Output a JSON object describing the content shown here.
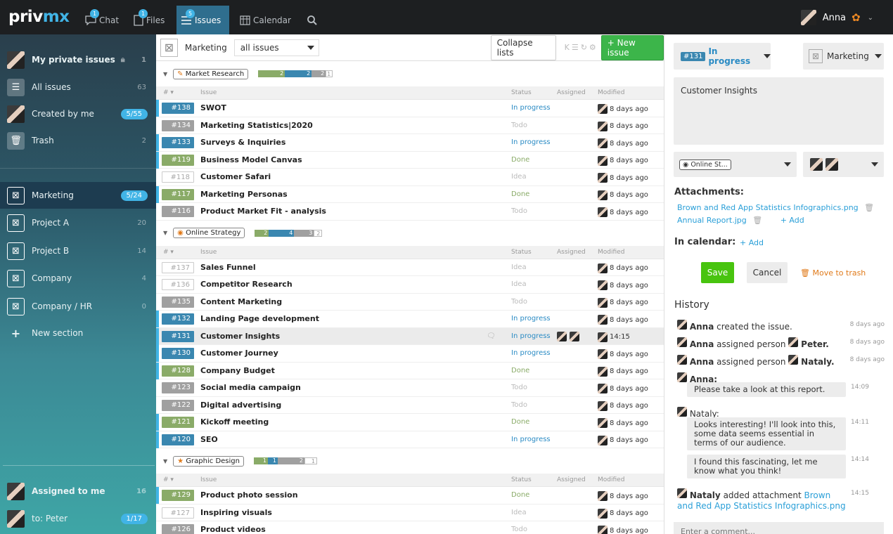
{
  "topbar": {
    "logo_priv": "priv",
    "logo_mx": "mx",
    "tabs": [
      {
        "label": "Chat",
        "badge": "1"
      },
      {
        "label": "Files",
        "badge": "1"
      },
      {
        "label": "Issues",
        "badge": "5"
      },
      {
        "label": "Calendar"
      }
    ],
    "user": "Anna"
  },
  "sidebar": {
    "top": [
      {
        "label": "My private issues",
        "count": "1"
      },
      {
        "label": "All issues",
        "count": "63"
      },
      {
        "label": "Created by me",
        "count": "5/55"
      },
      {
        "label": "Trash",
        "count": "2"
      }
    ],
    "sections": [
      {
        "label": "Marketing",
        "count": "5/24"
      },
      {
        "label": "Project A",
        "count": "20"
      },
      {
        "label": "Project B",
        "count": "14"
      },
      {
        "label": "Company",
        "count": "4"
      },
      {
        "label": "Company / HR",
        "count": "0"
      }
    ],
    "new_section": "New section",
    "bottom": [
      {
        "label": "Assigned to me",
        "count": "16"
      },
      {
        "label": "to: Peter",
        "count": "1/17"
      }
    ]
  },
  "listbar": {
    "section": "Marketing",
    "filter": "all issues",
    "collapse": "Collapse lists",
    "new_issue": "New issue"
  },
  "columns": {
    "num": "# ▾",
    "issue": "Issue",
    "status": "Status",
    "assigned": "Assigned",
    "modified": "Modified"
  },
  "groups": [
    {
      "label": "Market Research",
      "bars": [
        [
          "2",
          38
        ],
        [
          "2",
          38
        ],
        [
          "2",
          20
        ],
        [
          "1",
          10
        ]
      ],
      "rows": [
        {
          "num": "#138",
          "title": "SWOT",
          "status": "In progress",
          "mod": "8 days ago"
        },
        {
          "num": "#134",
          "title": "Marketing Statistics|2020",
          "status": "Todo",
          "mod": "8 days ago"
        },
        {
          "num": "#133",
          "title": "Surveys & Inquiries",
          "status": "In progress",
          "mod": "8 days ago"
        },
        {
          "num": "#119",
          "title": "Business Model Canvas",
          "status": "Done",
          "mod": "8 days ago"
        },
        {
          "num": "#118",
          "title": "Customer Safari",
          "status": "Idea",
          "mod": "8 days ago"
        },
        {
          "num": "#117",
          "title": "Marketing Personas",
          "status": "Done",
          "mod": "8 days ago"
        },
        {
          "num": "#116",
          "title": "Product Market Fit - analysis",
          "status": "Todo",
          "mod": "8 days ago"
        }
      ]
    },
    {
      "label": "Online Strategy",
      "bars": [
        [
          "2",
          20
        ],
        [
          "4",
          36
        ],
        [
          "3",
          28
        ],
        [
          "2",
          12
        ]
      ],
      "rows": [
        {
          "num": "#137",
          "title": "Sales Funnel",
          "status": "Idea",
          "mod": "8 days ago"
        },
        {
          "num": "#136",
          "title": "Competitor Research",
          "status": "Idea",
          "mod": "8 days ago"
        },
        {
          "num": "#135",
          "title": "Content Marketing",
          "status": "Todo",
          "mod": "8 days ago"
        },
        {
          "num": "#132",
          "title": "Landing Page development",
          "status": "In progress",
          "mod": "8 days ago"
        },
        {
          "num": "#131",
          "title": "Customer Insights",
          "status": "In progress",
          "mod": "14:15"
        },
        {
          "num": "#130",
          "title": "Customer Journey",
          "status": "In progress",
          "mod": "8 days ago"
        },
        {
          "num": "#128",
          "title": "Company Budget",
          "status": "Done",
          "mod": "8 days ago"
        },
        {
          "num": "#123",
          "title": "Social media campaign",
          "status": "Todo",
          "mod": "8 days ago"
        },
        {
          "num": "#122",
          "title": "Digital advertising",
          "status": "Todo",
          "mod": "8 days ago"
        },
        {
          "num": "#121",
          "title": "Kickoff meeting",
          "status": "Done",
          "mod": "8 days ago"
        },
        {
          "num": "#120",
          "title": "SEO",
          "status": "In progress",
          "mod": "8 days ago"
        }
      ]
    },
    {
      "label": "Graphic Design",
      "bars": [
        [
          "1",
          20
        ],
        [
          "1",
          14
        ],
        [
          "2",
          38
        ],
        [
          "1",
          18
        ]
      ],
      "rows": [
        {
          "num": "#129",
          "title": "Product photo session",
          "status": "Done",
          "mod": "8 days ago"
        },
        {
          "num": "#127",
          "title": "Inspiring visuals",
          "status": "Idea",
          "mod": "8 days ago"
        },
        {
          "num": "#126",
          "title": "Product videos",
          "status": "Todo",
          "mod": "8 days ago"
        }
      ]
    }
  ],
  "detail": {
    "issue_num": "#131",
    "status": "In progress",
    "section": "Marketing",
    "title": "Customer Insights",
    "list": "Online St...",
    "attachments_label": "Attachments:",
    "attachments": [
      "Brown and Red App Statistics Infographics.png",
      "Annual Report.jpg"
    ],
    "add": "Add",
    "calendar_label": "In calendar:",
    "save": "Save",
    "cancel": "Cancel",
    "trash": "Move to trash",
    "history_label": "History",
    "history": [
      {
        "who": "Anna",
        "text": "created the issue.",
        "time": "8 days ago"
      },
      {
        "who": "Anna",
        "text": "assigned person",
        "target": "Peter.",
        "time": "8 days ago"
      },
      {
        "who": "Anna",
        "text": "assigned person",
        "target": "Nataly.",
        "time": "8 days ago"
      }
    ],
    "c1_who": "Anna:",
    "c1_text": "Please take a look at this report.",
    "c1_time": "14:09",
    "c2_who": "Nataly:",
    "c2_text": "Looks interesting! I'll look into this, some data seems essential in terms of our audience.",
    "c2_time": "14:11",
    "c3_text": "I found this fascinating, let me know what you think!",
    "c3_time": "14:14",
    "att_who": "Nataly",
    "att_text": "added attachment",
    "att_link": "Brown and Red App Statistics Infographics.png",
    "att_time": "14:15",
    "comment_placeholder": "Enter a comment..."
  },
  "colors": {
    "in_progress": "#3a87b0",
    "todo": "#a0a0a0",
    "done": "#8aab68",
    "idea": "#ffffff",
    "accent": "#41b4e6"
  }
}
